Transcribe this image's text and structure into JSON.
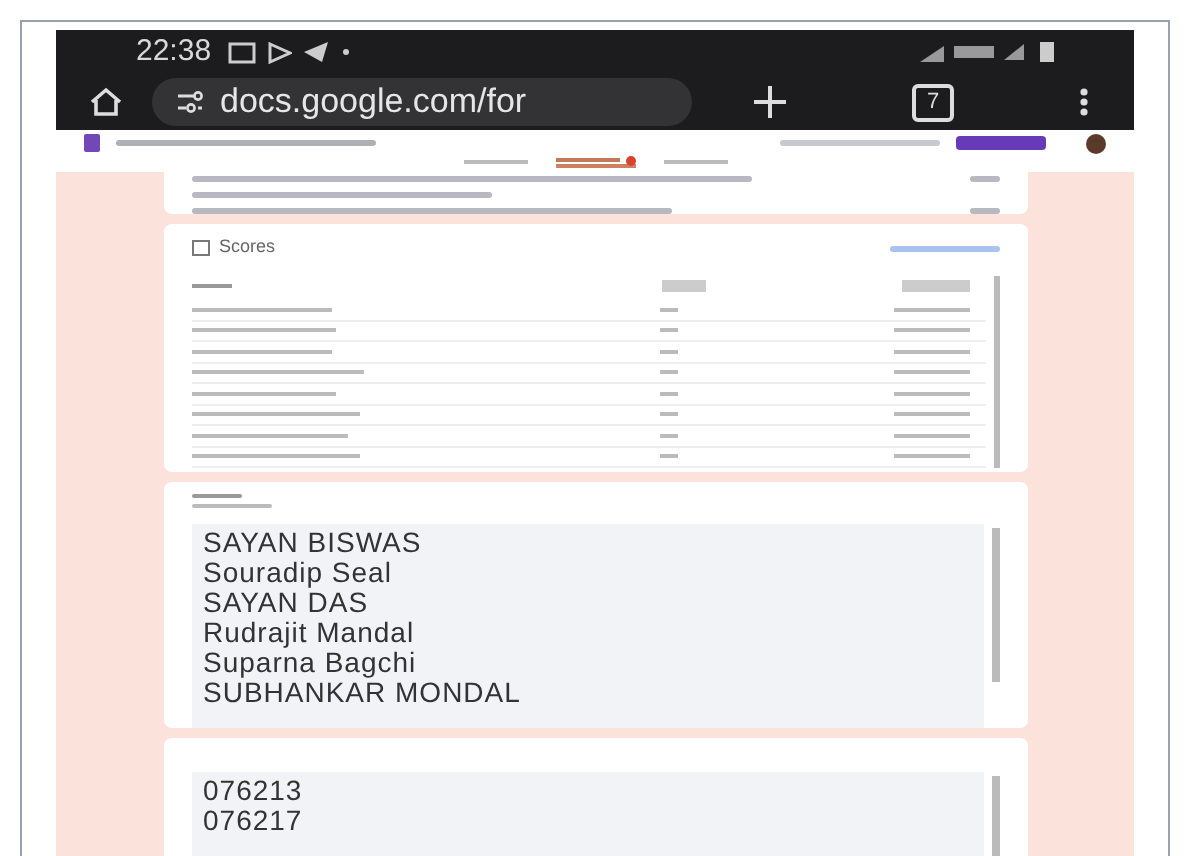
{
  "status_bar": {
    "time": "22:38"
  },
  "browser": {
    "url": "docs.google.com/for",
    "tab_count": "7"
  },
  "form_tabs": [
    {
      "selected": false
    },
    {
      "selected": true
    },
    {
      "selected": false
    }
  ],
  "scores": {
    "title": "Scores"
  },
  "name_question": {
    "answers": [
      "SAYAN BISWAS",
      "Souradip Seal",
      "SAYAN DAS",
      "Rudrajit Mandal",
      "Suparna Bagchi",
      "SUBHANKAR MONDAL"
    ]
  },
  "registration_question": {
    "answers": [
      "076213",
      "076217"
    ]
  }
}
